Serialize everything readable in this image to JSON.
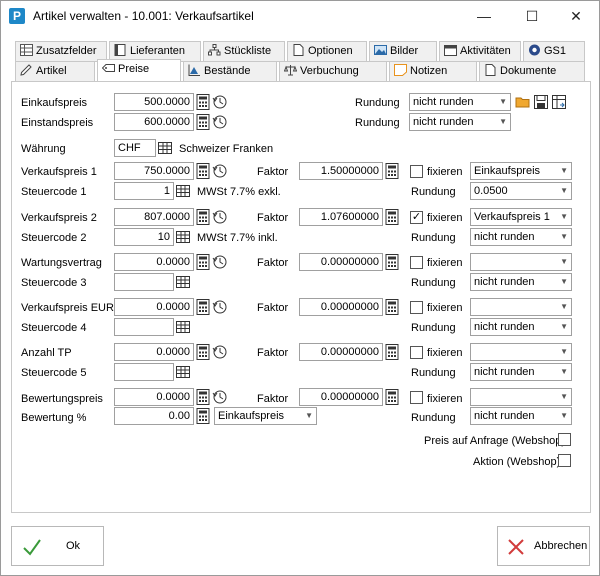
{
  "window": {
    "app_icon_letter": "P",
    "title": "Artikel verwalten - 10.001: Verkaufsartikel",
    "minimize": "—",
    "maximize": "☐",
    "close": "✕"
  },
  "tabs_row1": [
    {
      "label": "Zusatzfelder",
      "icon": "grid-icon"
    },
    {
      "label": "Lieferanten",
      "icon": "book-icon"
    },
    {
      "label": "Stückliste",
      "icon": "tree-icon"
    },
    {
      "label": "Optionen",
      "icon": "page-icon"
    },
    {
      "label": "Bilder",
      "icon": "image-icon"
    },
    {
      "label": "Aktivitäten",
      "icon": "calendar-icon"
    },
    {
      "label": "GS1",
      "icon": "gs1-icon"
    }
  ],
  "tabs_row2": [
    {
      "label": "Artikel",
      "icon": "pencil-icon"
    },
    {
      "label": "Preise",
      "icon": "price-tag-icon"
    },
    {
      "label": "Bestände",
      "icon": "chart-icon"
    },
    {
      "label": "Verbuchung",
      "icon": "scale-icon"
    },
    {
      "label": "Notizen",
      "icon": "note-icon"
    },
    {
      "label": "Dokumente",
      "icon": "document-icon"
    }
  ],
  "form": {
    "einkaufspreis_label": "Einkaufspreis",
    "einkaufspreis_value": "500.0000",
    "einstandspreis_label": "Einstandspreis",
    "einstandspreis_value": "600.0000",
    "rundung_label": "Rundung",
    "rundung1_value": "nicht runden",
    "rundung2_value": "nicht runden",
    "waehrung_label": "Währung",
    "waehrung_value": "CHF",
    "waehrung_name": "Schweizer Franken",
    "faktor_label": "Faktor",
    "fixieren_label": "fixieren",
    "steuercode_suffix_1": "MWSt 7.7% exkl.",
    "steuercode_suffix_2": "MWSt 7.7% inkl.",
    "rows": [
      {
        "label": "Verkaufspreis 1",
        "value": "750.0000",
        "faktor": "1.50000000",
        "fixed": false,
        "fix_ref": "Einkaufspreis",
        "sc_label": "Steuercode 1",
        "sc_value": "1",
        "sc_text": "MWSt 7.7% exkl.",
        "rundung": "0.0500"
      },
      {
        "label": "Verkaufspreis 2",
        "value": "807.0000",
        "faktor": "1.07600000",
        "fixed": true,
        "fix_ref": "Verkaufspreis 1",
        "sc_label": "Steuercode 2",
        "sc_value": "10",
        "sc_text": "MWSt 7.7% inkl.",
        "rundung": "nicht runden"
      },
      {
        "label": "Wartungsvertrag",
        "value": "0.0000",
        "faktor": "0.00000000",
        "fixed": false,
        "fix_ref": "",
        "sc_label": "Steuercode 3",
        "sc_value": "",
        "sc_text": "",
        "rundung": "nicht runden"
      },
      {
        "label": "Verkaufspreis EUR",
        "value": "0.0000",
        "faktor": "0.00000000",
        "fixed": false,
        "fix_ref": "",
        "sc_label": "Steuercode 4",
        "sc_value": "",
        "sc_text": "",
        "rundung": "nicht runden"
      },
      {
        "label": "Anzahl TP",
        "value": "0.0000",
        "faktor": "0.00000000",
        "fixed": false,
        "fix_ref": "",
        "sc_label": "Steuercode 5",
        "sc_value": "",
        "sc_text": "",
        "rundung": "nicht runden"
      }
    ],
    "bewertungspreis_label": "Bewertungspreis",
    "bewertungspreis_value": "0.0000",
    "bewertungspreis_faktor": "0.00000000",
    "bewertungspreis_fix_ref": "",
    "bewertung_pct_label": "Bewertung %",
    "bewertung_pct_value": "0.00",
    "bewertung_basis": "Einkaufspreis",
    "bewertung_rundung": "nicht runden",
    "preis_auf_anfrage_label": "Preis auf Anfrage (Webshop)",
    "aktion_label": "Aktion (Webshop)"
  },
  "buttons": {
    "ok_label": "Ok",
    "cancel_label": "Abbrechen"
  },
  "colors": {
    "ok_check": "#3a9a3a",
    "cancel_x": "#d23b3b",
    "accent": "#1e88c8"
  }
}
